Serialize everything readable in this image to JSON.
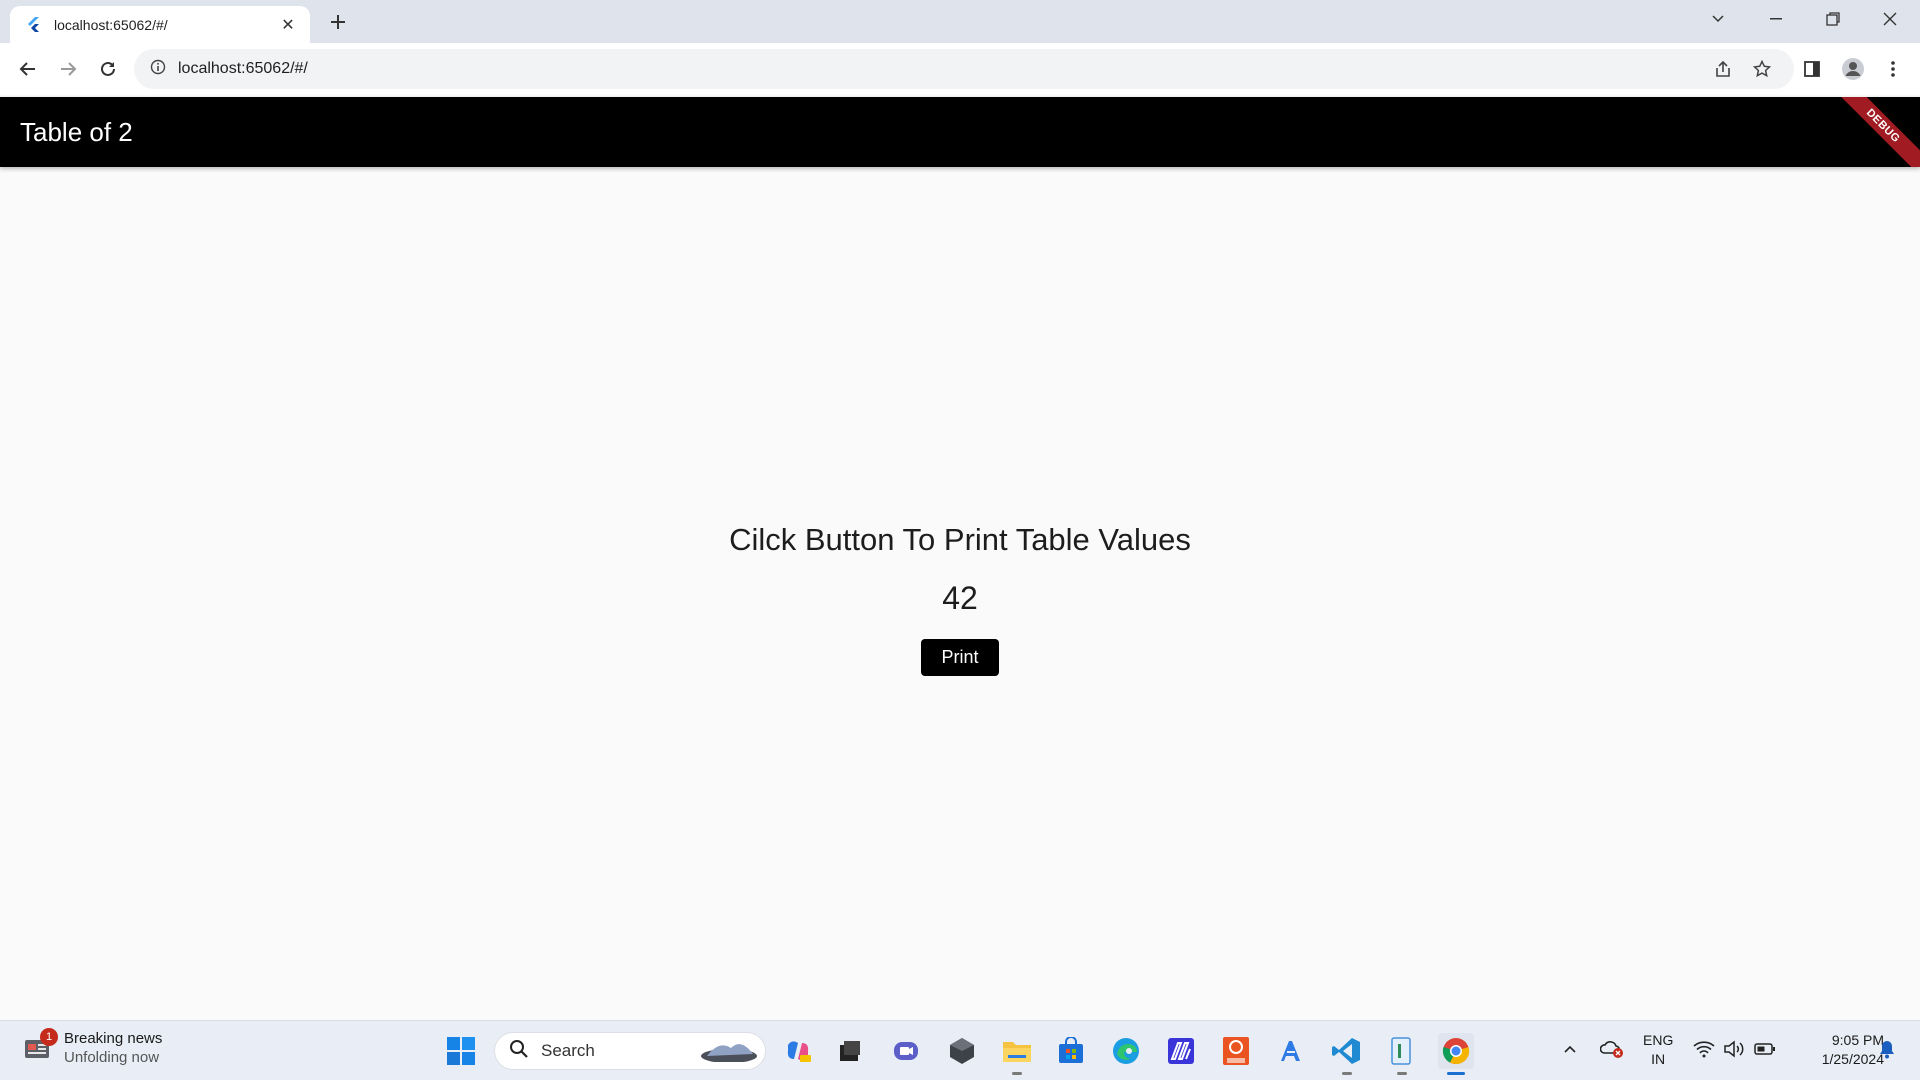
{
  "browser": {
    "tab": {
      "title": "localhost:65062/#/"
    },
    "address": {
      "url": "localhost:65062/#/"
    }
  },
  "app": {
    "title": "Table of 2",
    "debug_label": "DEBUG",
    "heading": "Cilck Button To Print Table Values",
    "value": "42",
    "print_label": "Print"
  },
  "taskbar": {
    "news": {
      "badge": "1",
      "title": "Breaking news",
      "subtitle": "Unfolding now"
    },
    "search_label": "Search",
    "language": {
      "line1": "ENG",
      "line2": "IN"
    },
    "clock": {
      "time": "9:05 PM",
      "date": "1/25/2024"
    }
  },
  "colors": {
    "appbar": "#000000",
    "debug_banner": "#a01b22",
    "button": "#000000",
    "background": "#fafafa"
  }
}
